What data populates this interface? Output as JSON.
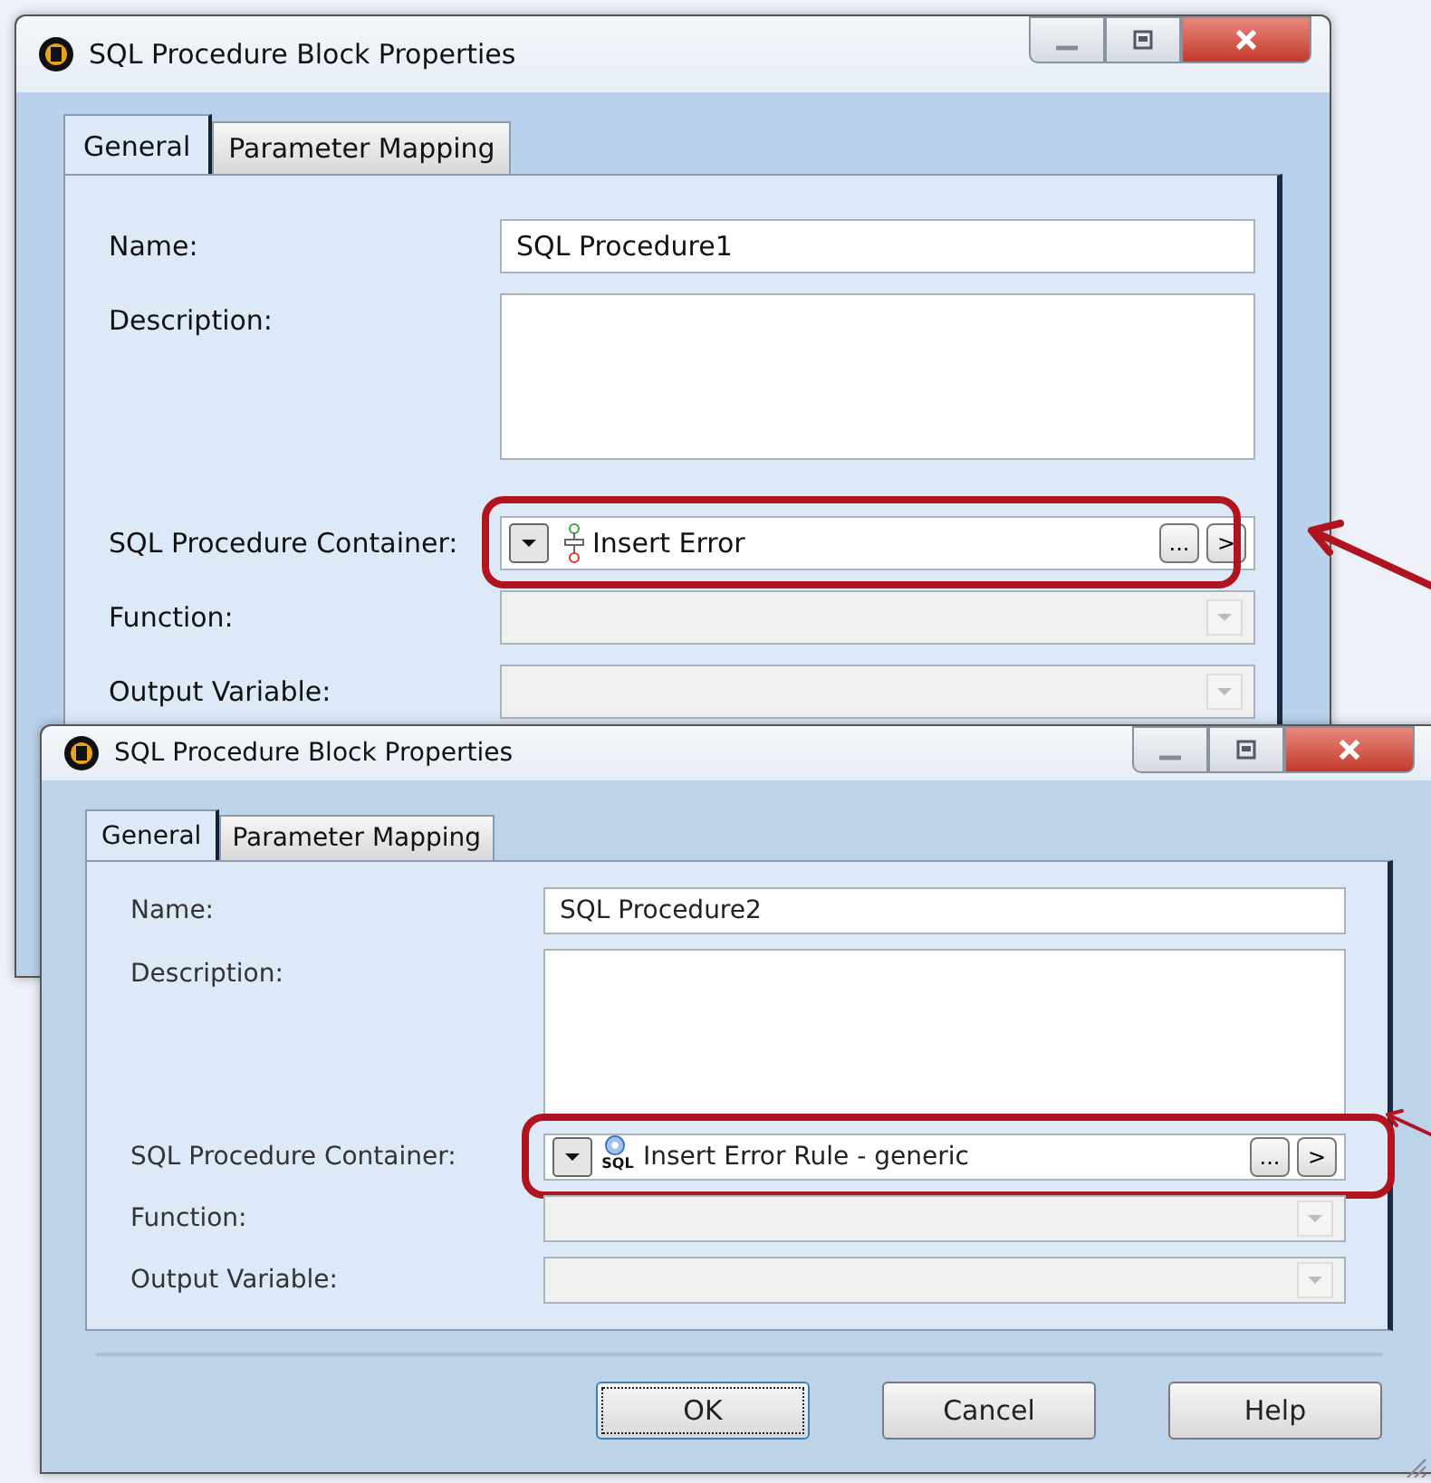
{
  "windows": [
    {
      "title": "SQL Procedure Block Properties",
      "tabs": [
        {
          "label": "General",
          "selected": true
        },
        {
          "label": "Parameter Mapping",
          "selected": false
        }
      ],
      "fields": [
        {
          "label": "Name:",
          "kind": "text",
          "value": "SQL Procedure1"
        },
        {
          "label": "Description:",
          "kind": "textarea"
        },
        {
          "label": "SQL Procedure Container:",
          "kind": "container",
          "value": "Insert Error",
          "browse": "...",
          "go": ">",
          "highlighted": true
        },
        {
          "label": "Function:",
          "kind": "dropdown"
        },
        {
          "label": "Output Variable:",
          "kind": "dropdown"
        }
      ]
    },
    {
      "title": "SQL Procedure Block Properties",
      "tabs": [
        {
          "label": "General",
          "selected": true
        },
        {
          "label": "Parameter Mapping",
          "selected": false
        }
      ],
      "fields": [
        {
          "label": "Name:",
          "kind": "text",
          "value": "SQL Procedure2"
        },
        {
          "label": "Description:",
          "kind": "textarea"
        },
        {
          "label": "SQL Procedure Container:",
          "kind": "container",
          "value": "Insert Error Rule - generic",
          "icon_text": "SQL",
          "browse": "...",
          "go": ">",
          "highlighted": true
        },
        {
          "label": "Function:",
          "kind": "dropdown"
        },
        {
          "label": "Output Variable:",
          "kind": "dropdown"
        }
      ],
      "buttons": [
        {
          "label": "OK",
          "focused": true
        },
        {
          "label": "Cancel",
          "focused": false
        },
        {
          "label": "Help",
          "focused": false
        }
      ]
    }
  ]
}
